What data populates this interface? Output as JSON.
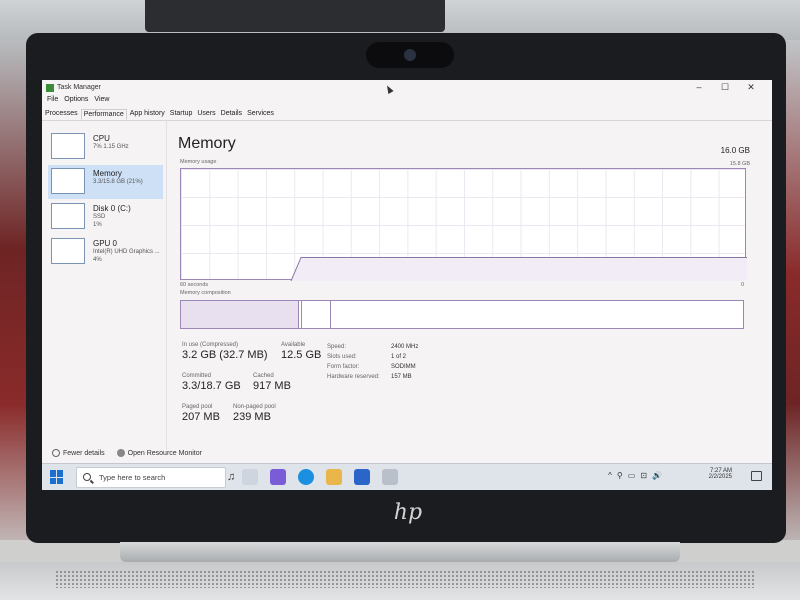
{
  "window": {
    "title": "Task Manager",
    "controls": [
      "–",
      "☐",
      "✕"
    ]
  },
  "menu": [
    "File",
    "Options",
    "View"
  ],
  "tabs": [
    "Processes",
    "Performance",
    "App history",
    "Startup",
    "Users",
    "Details",
    "Services"
  ],
  "active_tab": "Performance",
  "sidebar": {
    "items": [
      {
        "name": "CPU",
        "sub1": "7% 1.15 GHz",
        "sub2": ""
      },
      {
        "name": "Memory",
        "sub1": "3.3/15.8 GB (21%)",
        "sub2": ""
      },
      {
        "name": "Disk 0 (C:)",
        "sub1": "SSD",
        "sub2": "1%"
      },
      {
        "name": "GPU 0",
        "sub1": "Intel(R) UHD Graphics ...",
        "sub2": "4%"
      }
    ],
    "selected": "Memory"
  },
  "memory": {
    "title": "Memory",
    "total": "16.0 GB",
    "usage_label": "Memory usage",
    "usage_max": "15.8 GB",
    "graph_left": "60 seconds",
    "graph_right": "0",
    "composition_label": "Memory composition",
    "usage_fraction": 0.21,
    "stats": {
      "in_use_label": "In use (Compressed)",
      "in_use_value": "3.2 GB (32.7 MB)",
      "available_label": "Available",
      "available_value": "12.5 GB",
      "committed_label": "Committed",
      "committed_value": "3.3/18.7 GB",
      "cached_label": "Cached",
      "cached_value": "917 MB",
      "paged_label": "Paged pool",
      "paged_value": "207 MB",
      "nonpaged_label": "Non-paged pool",
      "nonpaged_value": "239 MB"
    },
    "details": {
      "speed_label": "Speed:",
      "speed_value": "2400 MHz",
      "slots_label": "Slots used:",
      "slots_value": "1 of 2",
      "form_label": "Form factor:",
      "form_value": "SODIMM",
      "reserved_label": "Hardware reserved:",
      "reserved_value": "157 MB"
    }
  },
  "footer": {
    "fewer_details": "Fewer details",
    "open_monitor": "Open Resource Monitor"
  },
  "taskbar": {
    "search_placeholder": "Type here to search",
    "time": "7:27 AM",
    "date": "2/2/2025",
    "tray_icons": [
      "^",
      "⚲",
      "▭",
      "⊡",
      "🔊"
    ],
    "colors": {
      "start": "#1a6fd0",
      "edge": "#1b8fe0",
      "store": "#2b65c7",
      "files": "#e8b64a",
      "copilot": "#7a5cd6"
    }
  },
  "colors": {
    "accent": "#9b86b5",
    "selection": "#cde0f5"
  }
}
